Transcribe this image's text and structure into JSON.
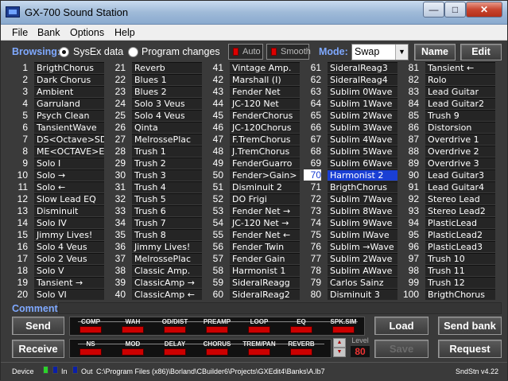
{
  "window": {
    "title": "GX-700 Sound Station",
    "min": "—",
    "max": "□",
    "close": "✕"
  },
  "menu": [
    "File",
    "Bank",
    "Options",
    "Help"
  ],
  "browse": {
    "label": "Browsing:",
    "opt_sysex": "SysEx data",
    "opt_program": "Program changes",
    "auto": "Auto",
    "smooth": "Smooth",
    "mode_label": "Mode:",
    "mode_value": "Swap",
    "name_btn": "Name",
    "edit_btn": "Edit"
  },
  "patches": [
    [
      "1",
      "BrigthChorus"
    ],
    [
      "2",
      "Dark Chorus"
    ],
    [
      "3",
      "Ambient"
    ],
    [
      "4",
      "Garruland"
    ],
    [
      "5",
      "Psych Clean"
    ],
    [
      "6",
      "TansientWave"
    ],
    [
      "7",
      "DS<Octave>SD"
    ],
    [
      "8",
      "ME<OCTAVE>EM"
    ],
    [
      "9",
      "Solo I"
    ],
    [
      "10",
      "Solo →"
    ],
    [
      "11",
      "Solo ←"
    ],
    [
      "12",
      "Slow Lead EQ"
    ],
    [
      "13",
      "Disminuit"
    ],
    [
      "14",
      "Solo IV"
    ],
    [
      "15",
      "Jimmy Lives!"
    ],
    [
      "16",
      "Solo 4 Veus"
    ],
    [
      "17",
      "Solo 2 Veus"
    ],
    [
      "18",
      "Solo V"
    ],
    [
      "19",
      "Tansient →"
    ],
    [
      "20",
      "Solo VI"
    ],
    [
      "21",
      "Reverb"
    ],
    [
      "22",
      "Blues 1"
    ],
    [
      "23",
      "Blues 2"
    ],
    [
      "24",
      "Solo 3 Veus"
    ],
    [
      "25",
      "Solo 4 Veus"
    ],
    [
      "26",
      "Qinta"
    ],
    [
      "27",
      "MelrossePlac"
    ],
    [
      "28",
      "Trush 1"
    ],
    [
      "29",
      "Trush 2"
    ],
    [
      "30",
      "Trush 3"
    ],
    [
      "31",
      "Trush 4"
    ],
    [
      "32",
      "Trush 5"
    ],
    [
      "33",
      "Trush 6"
    ],
    [
      "34",
      "Trush 7"
    ],
    [
      "35",
      "Trush 8"
    ],
    [
      "36",
      "Jimmy Lives!"
    ],
    [
      "37",
      "MelrossePlac"
    ],
    [
      "38",
      "Classic Amp."
    ],
    [
      "39",
      "ClassicAmp →"
    ],
    [
      "40",
      "ClassicAmp ←"
    ],
    [
      "41",
      "Vintage Amp."
    ],
    [
      "42",
      "Marshall (I)"
    ],
    [
      "43",
      "Fender Net"
    ],
    [
      "44",
      "JC-120 Net"
    ],
    [
      "45",
      "FenderChorus"
    ],
    [
      "46",
      "JC-120Chorus"
    ],
    [
      "47",
      "F.TremChorus"
    ],
    [
      "48",
      "J.TremChorus"
    ],
    [
      "49",
      "FenderGuarro"
    ],
    [
      "50",
      "Fender>Gain>"
    ],
    [
      "51",
      "Disminuit 2"
    ],
    [
      "52",
      "DO Frigi"
    ],
    [
      "53",
      "Fender Net →"
    ],
    [
      "54",
      "JC-120 Net →"
    ],
    [
      "55",
      "Fender Net ←"
    ],
    [
      "56",
      "Fender Twin"
    ],
    [
      "57",
      "Fender Gain"
    ],
    [
      "58",
      "Harmonist 1"
    ],
    [
      "59",
      "SideralReagg"
    ],
    [
      "60",
      "SideralReag2"
    ],
    [
      "61",
      "SideralReag3"
    ],
    [
      "62",
      "SideralReag4"
    ],
    [
      "63",
      "Sublim 0Wave"
    ],
    [
      "64",
      "Sublim 1Wave"
    ],
    [
      "65",
      "Sublim 2Wave"
    ],
    [
      "66",
      "Sublim 3Wave"
    ],
    [
      "67",
      "Sublim 4Wave"
    ],
    [
      "68",
      "Sublim 5Wave"
    ],
    [
      "69",
      "Sublim 6Wave"
    ],
    [
      "70",
      "Harmonist 2"
    ],
    [
      "71",
      "BrigthChorus"
    ],
    [
      "72",
      "Sublim 7Wave"
    ],
    [
      "73",
      "Sublim 8Wave"
    ],
    [
      "74",
      "Sublim 9Wave"
    ],
    [
      "75",
      "Sublim IWave"
    ],
    [
      "76",
      "Sublim →Wave"
    ],
    [
      "77",
      "Sublim 2Wave"
    ],
    [
      "78",
      "Sublim AWave"
    ],
    [
      "79",
      "Carlos Sainz"
    ],
    [
      "80",
      "Disminuit 3"
    ],
    [
      "81",
      "Tansient ←"
    ],
    [
      "82",
      "Rolo"
    ],
    [
      "83",
      "Lead Guitar"
    ],
    [
      "84",
      "Lead Guitar2"
    ],
    [
      "85",
      "Trush 9"
    ],
    [
      "86",
      "Distorsion"
    ],
    [
      "87",
      "Overdrive 1"
    ],
    [
      "88",
      "Overdrive 2"
    ],
    [
      "89",
      "Overdrive 3"
    ],
    [
      "90",
      "Lead Guitar3"
    ],
    [
      "91",
      "Lead Guitar4"
    ],
    [
      "92",
      "Stereo Lead"
    ],
    [
      "93",
      "Stereo Lead2"
    ],
    [
      "94",
      "PlasticLead"
    ],
    [
      "95",
      "PlasticLead2"
    ],
    [
      "96",
      "PlasticLead3"
    ],
    [
      "97",
      "Trush 10"
    ],
    [
      "98",
      "Trush 11"
    ],
    [
      "99",
      "Trush 12"
    ],
    [
      "100",
      "BrigthChorus"
    ]
  ],
  "selected_patch": "70",
  "comment_label": "Comment:",
  "comment_value": "",
  "buttons": {
    "send": "Send",
    "receive": "Receive",
    "load": "Load",
    "save": "Save",
    "send_bank": "Send bank",
    "request": "Request"
  },
  "fx_row1": [
    "COMP",
    "WAH",
    "OD/DIST",
    "PREAMP",
    "LOOP",
    "EQ",
    "SPK.SIM"
  ],
  "fx_row2": [
    "NS",
    "MOD",
    "DELAY",
    "CHORUS",
    "TREM/PAN",
    "REVERB"
  ],
  "level_label": "Level",
  "level_value": "80",
  "status": {
    "device": "Device",
    "in": "In",
    "out": "Out",
    "path": "C:\\Program Files (x86)\\Borland\\CBuilder6\\Projects\\GXEdit4\\Banks\\A.lb7",
    "version": "SndStn v4.22"
  },
  "colors": {
    "accent": "#7fa9ff",
    "selected": "#1a3fd4",
    "led": "#cc0000"
  }
}
